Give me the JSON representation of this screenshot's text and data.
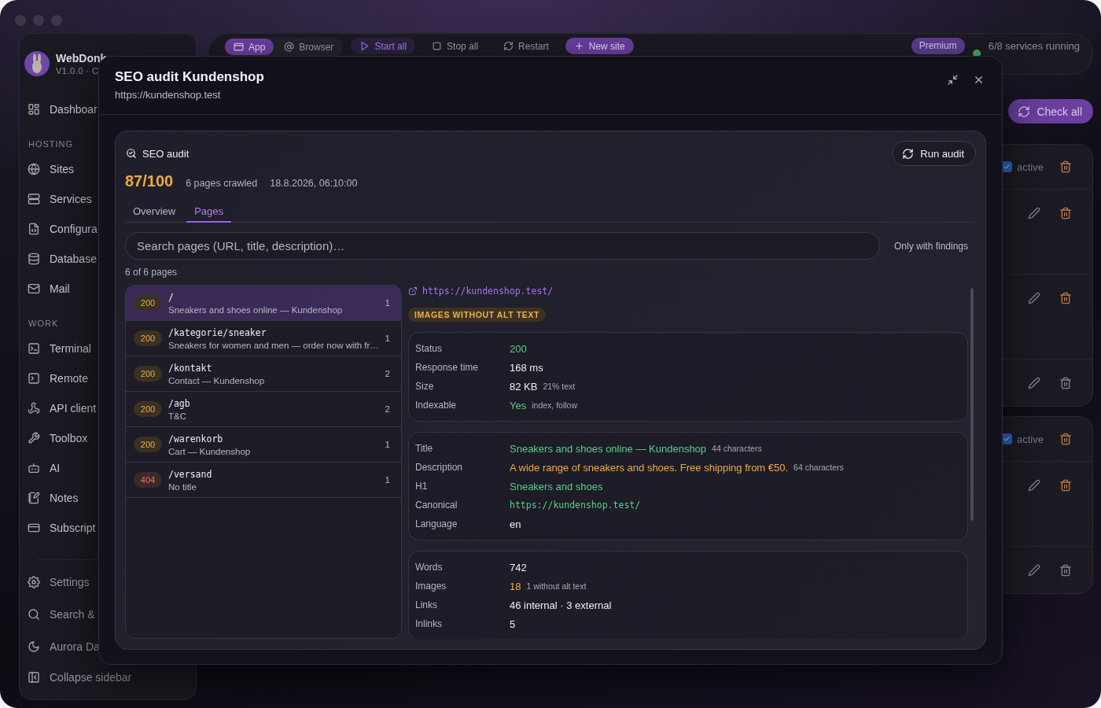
{
  "sidebar": {
    "app_name": "WebDonk",
    "version": "V1.0.0 · C",
    "top_items": [
      {
        "label": "Dashboar"
      }
    ],
    "sections": [
      {
        "heading": "HOSTING",
        "items": [
          {
            "label": "Sites"
          },
          {
            "label": "Services"
          },
          {
            "label": "Configura"
          },
          {
            "label": "Database"
          },
          {
            "label": "Mail"
          }
        ]
      },
      {
        "heading": "WORK",
        "items": [
          {
            "label": "Terminal"
          },
          {
            "label": "Remote"
          },
          {
            "label": "API client"
          },
          {
            "label": "Toolbox"
          },
          {
            "label": "AI"
          },
          {
            "label": "Notes"
          },
          {
            "label": "Subscript"
          }
        ]
      }
    ],
    "footer_items": [
      {
        "label": "Settings"
      },
      {
        "label": "Search &"
      },
      {
        "label": "Aurora Da"
      },
      {
        "label": "Collapse sidebar"
      }
    ]
  },
  "toolbar": {
    "view_tabs": [
      {
        "label": "App",
        "selected": true
      },
      {
        "label": "Browser",
        "selected": false
      }
    ],
    "actions": [
      {
        "label": "Start all",
        "kind": "accent"
      },
      {
        "label": "Stop all",
        "kind": "plain"
      },
      {
        "label": "Restart",
        "kind": "plain"
      },
      {
        "label": "New site",
        "kind": "primary"
      }
    ],
    "plan_badge": "Premium",
    "status": "6/8 services running"
  },
  "sites_panel": {
    "check_button": "Check all",
    "groups": [
      {
        "rows": [
          {
            "kind": "status",
            "checked": true,
            "label": "active"
          },
          {
            "kind": "actions",
            "delete_muted": false
          },
          {
            "kind": "actions",
            "delete_muted": false
          },
          {
            "kind": "actions",
            "delete_muted": true
          }
        ]
      },
      {
        "rows": [
          {
            "kind": "status",
            "checked": true,
            "label": "active"
          },
          {
            "kind": "actions",
            "delete_muted": false
          },
          {
            "kind": "actions",
            "delete_muted": true
          }
        ]
      }
    ]
  },
  "dialog": {
    "title": "SEO audit Kundenshop",
    "subtitle": "https://kundenshop.test",
    "audit": {
      "heading": "SEO audit",
      "run_button": "Run audit",
      "score": "87/100",
      "pages_crawled": "6 pages crawled",
      "timestamp": "18.8.2026, 06:10:00",
      "tabs": [
        {
          "label": "Overview",
          "selected": false
        },
        {
          "label": "Pages",
          "selected": true
        }
      ],
      "search": {
        "placeholder": "Search pages (URL, title, description)…"
      },
      "filter": "Only with findings",
      "count": "6 of 6 pages",
      "pages": [
        {
          "status": "200",
          "kind": "ok",
          "path": "/",
          "title": "Sneakers and shoes online — Kundenshop",
          "findings": "1",
          "selected": true
        },
        {
          "status": "200",
          "kind": "ok",
          "path": "/kategorie/sneaker",
          "title": "Sneakers for women and men — order now with fr…",
          "findings": "1",
          "selected": false
        },
        {
          "status": "200",
          "kind": "ok",
          "path": "/kontakt",
          "title": "Contact — Kundenshop",
          "findings": "2",
          "selected": false
        },
        {
          "status": "200",
          "kind": "ok",
          "path": "/agb",
          "title": "T&C",
          "findings": "2",
          "selected": false
        },
        {
          "status": "200",
          "kind": "ok",
          "path": "/warenkorb",
          "title": "Cart — Kundenshop",
          "findings": "1",
          "selected": false
        },
        {
          "status": "404",
          "kind": "error",
          "path": "/versand",
          "title": "No title",
          "findings": "1",
          "selected": false
        }
      ],
      "detail": {
        "url": "https://kundenshop.test/",
        "badges": [
          "IMAGES WITHOUT ALT TEXT"
        ],
        "sections": [
          {
            "rows": [
              {
                "label": "Status",
                "value": "200",
                "kind": "good"
              },
              {
                "label": "Response time",
                "value": "168 ms",
                "kind": "plain"
              },
              {
                "label": "Size",
                "value": "82 KB",
                "note": "21% text",
                "kind": "plain"
              },
              {
                "label": "Indexable",
                "value": "Yes",
                "note": "index, follow",
                "kind": "good"
              }
            ]
          },
          {
            "rows": [
              {
                "label": "Title",
                "value": "Sneakers and shoes online — Kundenshop",
                "note": "44 characters",
                "kind": "good"
              },
              {
                "label": "Description",
                "value": "A wide range of sneakers and shoes. Free shipping from €50.",
                "note": "64 characters",
                "kind": "warn"
              },
              {
                "label": "H1",
                "value": "Sneakers and shoes",
                "kind": "good"
              },
              {
                "label": "Canonical",
                "value": "https://kundenshop.test/",
                "kind": "code"
              },
              {
                "label": "Language",
                "value": "en",
                "kind": "plain"
              }
            ]
          },
          {
            "rows": [
              {
                "label": "Words",
                "value": "742",
                "kind": "plain"
              },
              {
                "label": "Images",
                "value": "18",
                "note": "1 without alt text",
                "kind": "warn"
              },
              {
                "label": "Links",
                "value": "46 internal · 3 external",
                "kind": "plain"
              },
              {
                "label": "Inlinks",
                "value": "5",
                "kind": "plain"
              }
            ]
          }
        ]
      }
    }
  }
}
